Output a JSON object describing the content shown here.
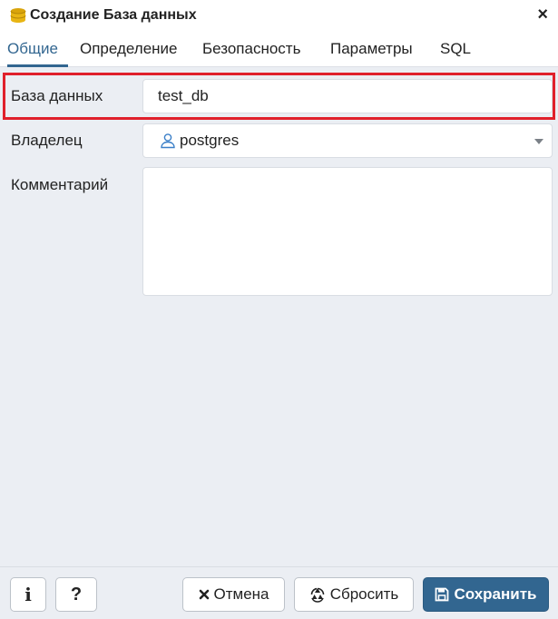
{
  "dialog": {
    "title": "Создание База данных",
    "close_glyph": "×",
    "icon": "database-icon"
  },
  "tabs": [
    {
      "label": "Общие",
      "active": true
    },
    {
      "label": "Определение",
      "active": false
    },
    {
      "label": "Безопасность",
      "active": false
    },
    {
      "label": "Параметры",
      "active": false
    },
    {
      "label": "SQL",
      "active": false
    }
  ],
  "form": {
    "database_label": "База данных",
    "database_value": "test_db",
    "owner_label": "Владелец",
    "owner_value": "postgres",
    "comment_label": "Комментарий",
    "comment_value": ""
  },
  "footer": {
    "info_label": "i",
    "help_label": "?",
    "cancel_label": "Отмена",
    "reset_label": "Сбросить",
    "save_label": "Сохранить"
  },
  "colors": {
    "accent": "#326690",
    "highlight": "#e0202b",
    "background": "#ebeef3"
  }
}
